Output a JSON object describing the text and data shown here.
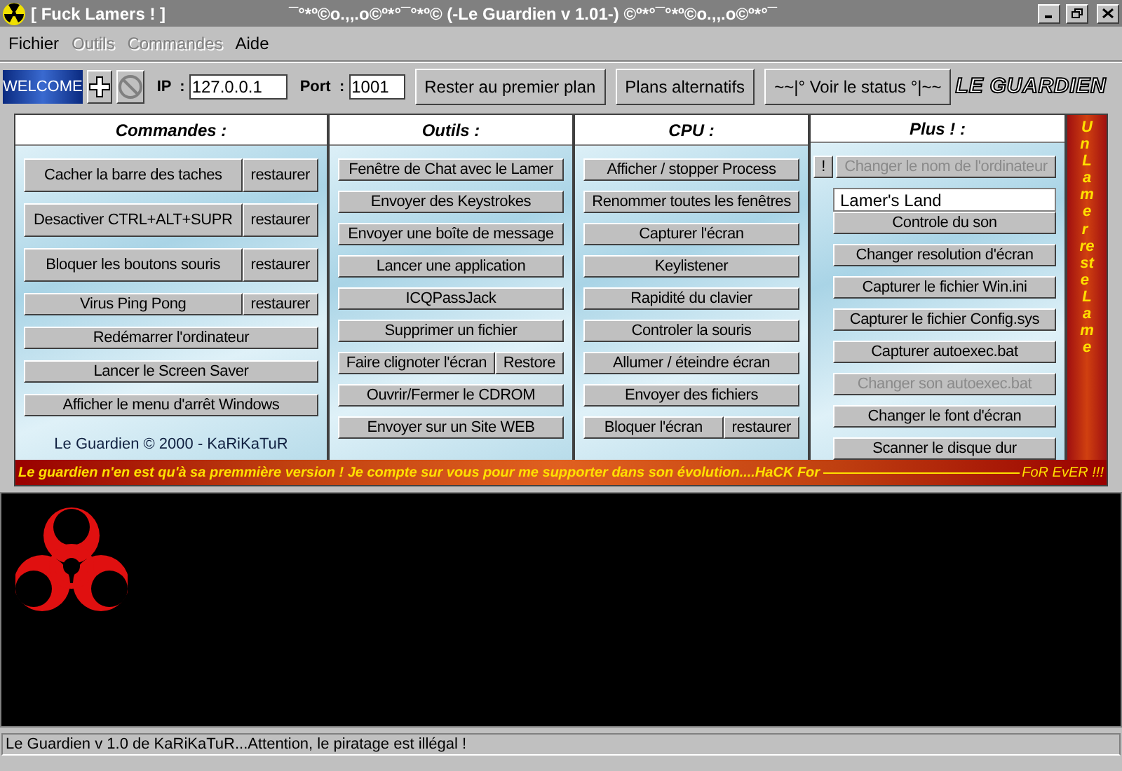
{
  "window": {
    "title": "[ Fuck Lamers ! ]",
    "banner": "¯°*º©o.,,.o©º*°¯°*º© (-Le Guardien v 1.01-) ©º*°¯°*º©o.,,.o©º*°¯"
  },
  "menu": [
    {
      "label": "Fichier",
      "disabled": false
    },
    {
      "label": "Outils",
      "disabled": true
    },
    {
      "label": "Commandes",
      "disabled": true
    },
    {
      "label": "Aide",
      "disabled": false
    }
  ],
  "toolbar": {
    "welcome": "WELCOME",
    "ip_label": "IP  :",
    "ip": "127.0.0.1",
    "port_label": "Port  :",
    "port": "1001",
    "buttons": [
      "Rester au premier plan",
      "Plans alternatifs",
      "~~|° Voir le status °|~~"
    ],
    "logo": "LE GUARDIEN"
  },
  "columns": [
    {
      "title": "Commandes  :",
      "items": [
        {
          "kind": "split",
          "label": "Cacher la barre des taches",
          "second": "restaurer",
          "disabled": false
        },
        {
          "kind": "split",
          "label": "Desactiver CTRL+ALT+SUPR",
          "second": "restaurer",
          "disabled": false
        },
        {
          "kind": "split",
          "label": "Bloquer les boutons souris",
          "second": "restaurer",
          "disabled": false
        },
        {
          "kind": "split",
          "label": "Virus Ping Pong",
          "second": "restaurer",
          "disabled": false
        },
        {
          "kind": "button",
          "label": "Redémarrer l'ordinateur",
          "disabled": false
        },
        {
          "kind": "button",
          "label": "Lancer le Screen Saver",
          "disabled": false
        },
        {
          "kind": "button",
          "label": "Afficher le menu d'arrêt Windows",
          "disabled": false
        },
        {
          "kind": "note",
          "label": "Le Guardien © 2000 - KaRiKaTuR"
        }
      ]
    },
    {
      "title": "Outils  :",
      "items": [
        {
          "kind": "button",
          "label": "Fenêtre de Chat avec le Lamer",
          "disabled": false
        },
        {
          "kind": "button",
          "label": "Envoyer des Keystrokes",
          "disabled": false
        },
        {
          "kind": "button",
          "label": "Envoyer une boîte de message",
          "disabled": false
        },
        {
          "kind": "button",
          "label": "Lancer une application",
          "disabled": false
        },
        {
          "kind": "button",
          "label": "ICQPassJack",
          "disabled": false
        },
        {
          "kind": "button",
          "label": "Supprimer un fichier",
          "disabled": false
        },
        {
          "kind": "split",
          "label": "Faire clignoter l'écran",
          "second": "Restore",
          "disabled": false
        },
        {
          "kind": "button",
          "label": "Ouvrir/Fermer le CDROM",
          "disabled": false
        },
        {
          "kind": "button",
          "label": "Envoyer sur un Site WEB",
          "disabled": false
        }
      ]
    },
    {
      "title": "CPU  :",
      "items": [
        {
          "kind": "button",
          "label": "Afficher / stopper Process",
          "disabled": false
        },
        {
          "kind": "button",
          "label": "Renommer toutes les fenêtres",
          "disabled": false
        },
        {
          "kind": "button",
          "label": "Capturer l'écran",
          "disabled": false
        },
        {
          "kind": "button",
          "label": "Keylistener",
          "disabled": false
        },
        {
          "kind": "button",
          "label": "Rapidité du clavier",
          "disabled": false
        },
        {
          "kind": "button",
          "label": "Controler la souris",
          "disabled": false
        },
        {
          "kind": "button",
          "label": "Allumer / éteindre écran",
          "disabled": false
        },
        {
          "kind": "button",
          "label": "Envoyer des fichiers",
          "disabled": false
        },
        {
          "kind": "split",
          "label": "Bloquer l'écran",
          "second": "restaurer",
          "disabled": false
        }
      ]
    },
    {
      "title": "Plus ! :",
      "items": [
        {
          "kind": "prefixed",
          "prefix": "!",
          "label": "Changer le nom de l'ordinateur",
          "disabled": true
        },
        {
          "kind": "field",
          "value": "Lamer's Land",
          "label": "Controle du son",
          "disabled": false
        },
        {
          "kind": "button",
          "label": "Changer resolution d'écran",
          "disabled": false
        },
        {
          "kind": "button",
          "label": "Capturer le fichier Win.ini",
          "disabled": false
        },
        {
          "kind": "button",
          "label": "Capturer le fichier Config.sys",
          "disabled": false
        },
        {
          "kind": "button",
          "label": "Capturer autoexec.bat",
          "disabled": false
        },
        {
          "kind": "button",
          "label": "Changer son autoexec.bat",
          "disabled": true
        },
        {
          "kind": "button",
          "label": "Changer le font d'écran",
          "disabled": false
        },
        {
          "kind": "button",
          "label": "Scanner le disque dur",
          "disabled": false
        }
      ]
    }
  ],
  "side_text": "Un Lamer reste Lame",
  "ticker": {
    "text": "Le guardien n'en est qu'à sa premmière version ! Je compte sur vous pour me supporter dans son évolution....HaCK For",
    "end": "FoR  EvER !!!"
  },
  "status_bar": "Le Guardien v 1.0 de KaRiKaTuR...Attention, le piratage est illégal !"
}
